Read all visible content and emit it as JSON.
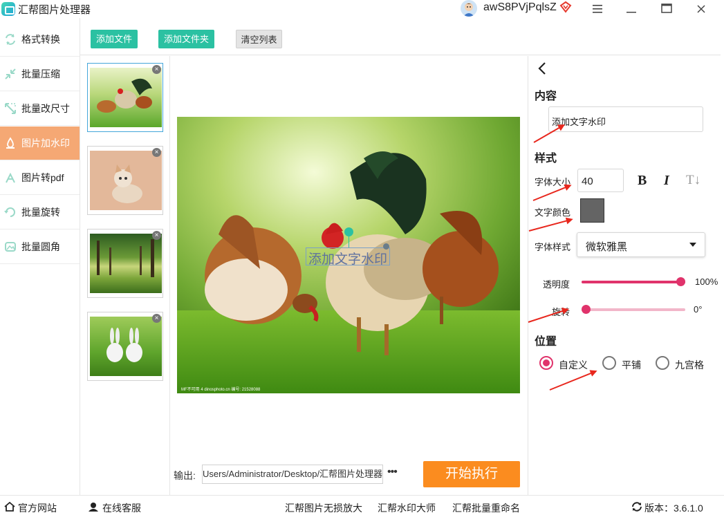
{
  "app": {
    "title": "汇帮图片处理器",
    "user_name": "awS8PVjPqlsZ"
  },
  "window_controls": [
    "menu-icon",
    "minimize-icon",
    "maximize-icon",
    "close-icon"
  ],
  "sidebar": {
    "items": [
      {
        "label": "格式转换",
        "icon": "format-convert-icon",
        "active": false
      },
      {
        "label": "批量压缩",
        "icon": "compress-icon",
        "active": false
      },
      {
        "label": "批量改尺寸",
        "icon": "resize-icon",
        "active": false
      },
      {
        "label": "图片加水印",
        "icon": "watermark-icon",
        "active": true
      },
      {
        "label": "图片转pdf",
        "icon": "pdf-icon",
        "active": false
      },
      {
        "label": "批量旋转",
        "icon": "rotate-icon",
        "active": false
      },
      {
        "label": "批量圆角",
        "icon": "round-corner-icon",
        "active": false
      }
    ]
  },
  "toolbar": {
    "add_file": "添加文件",
    "add_folder": "添加文件夹",
    "clear_list": "清空列表"
  },
  "thumbnails": [
    "chickens",
    "kitten",
    "forest",
    "rabbits"
  ],
  "preview": {
    "watermark_text": "添加文字水印",
    "photo_caption": "MF不可用 4 dinosphoto.cn  编号: 21528088"
  },
  "output": {
    "label": "输出:",
    "path": "Users/Administrator/Desktop/汇帮图片处理器",
    "more": "•••"
  },
  "start_button": "开始执行",
  "panel": {
    "back_icon": "chevron-left-icon",
    "content_heading": "内容",
    "content_value": "添加文字水印",
    "style_heading": "样式",
    "font_size_label": "字体大小",
    "font_size_value": "40",
    "bold_label": "B",
    "italic_label": "I",
    "vertical_label": "T↓",
    "text_color_label": "文字颜色",
    "text_color": "#646464",
    "font_style_label": "字体样式",
    "font_style_value": "微软雅黑",
    "opacity_label": "透明度",
    "opacity_value_text": "100%",
    "opacity_fraction": 1.0,
    "rotation_label": "旋转",
    "rotation_value_text": "0°",
    "rotation_fraction": 0.0,
    "position_heading": "位置",
    "position_options": [
      {
        "label": "自定义",
        "selected": true
      },
      {
        "label": "平铺",
        "selected": false
      },
      {
        "label": "九宫格",
        "selected": false
      }
    ]
  },
  "footer": {
    "website": "官方网站",
    "support": "在线客服",
    "link1": "汇帮图片无损放大",
    "link2": "汇帮水印大师",
    "link3": "汇帮批量重命名",
    "version": "版本：3.6.1.0"
  },
  "colors": {
    "accent_green": "#2bc1a2",
    "active_orange": "#f5a874",
    "start_orange": "#fb8c1f",
    "slider_pink": "#e0336b",
    "annotation_red": "#e8271d"
  }
}
